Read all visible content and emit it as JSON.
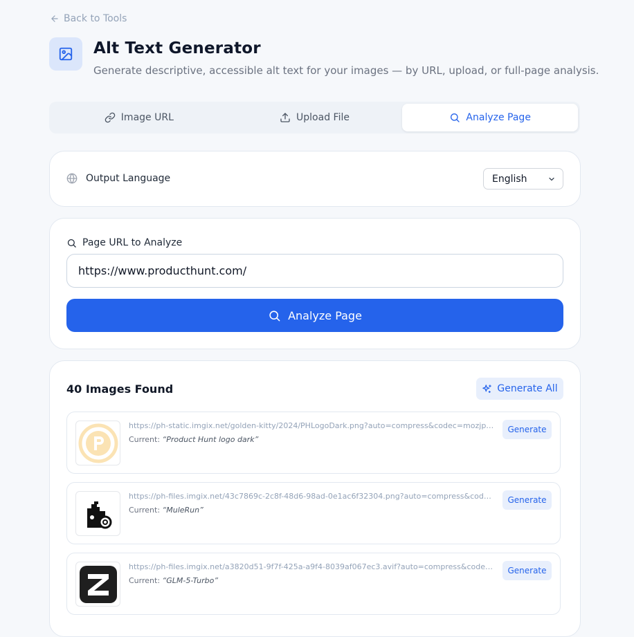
{
  "back": {
    "label": "Back to Tools"
  },
  "header": {
    "title": "Alt Text Generator",
    "subtitle": "Generate descriptive, accessible alt text for your images — by URL, upload, or full-page analysis."
  },
  "tabs": [
    {
      "label": "Image URL",
      "icon": "link-icon",
      "active": false
    },
    {
      "label": "Upload File",
      "icon": "upload-icon",
      "active": false
    },
    {
      "label": "Analyze Page",
      "icon": "search-icon",
      "active": true
    }
  ],
  "language": {
    "label": "Output Language",
    "selected": "English"
  },
  "analyze": {
    "label": "Page URL to Analyze",
    "url_value": "https://www.producthunt.com/",
    "button_label": "Analyze Page"
  },
  "results": {
    "title": "40 Images Found",
    "generate_all_label": "Generate All",
    "current_prefix": "Current:",
    "generate_label": "Generate",
    "images": [
      {
        "url": "https://ph-static.imgix.net/golden-kitty/2024/PHLogoDark.png?auto=compress&codec=mozjpeg&cs=strip",
        "current": "“Product Hunt logo dark”",
        "thumb": "product-hunt-logo"
      },
      {
        "url": "https://ph-files.imgix.net/43c7869c-2c8f-48d6-98ad-0e1ac6f32304.png?auto=compress&codec=mozjpeg",
        "current": "“MuleRun”",
        "thumb": "mulerun-logo"
      },
      {
        "url": "https://ph-files.imgix.net/a3820d51-9f7f-425a-a9f4-8039af067ec3.avif?auto=compress&codec=mozjpeg",
        "current": "“GLM-5-Turbo”",
        "thumb": "glm-logo"
      }
    ]
  },
  "colors": {
    "accent": "#2563eb",
    "accent_soft": "#e8effc",
    "background": "#f6f8fb"
  }
}
